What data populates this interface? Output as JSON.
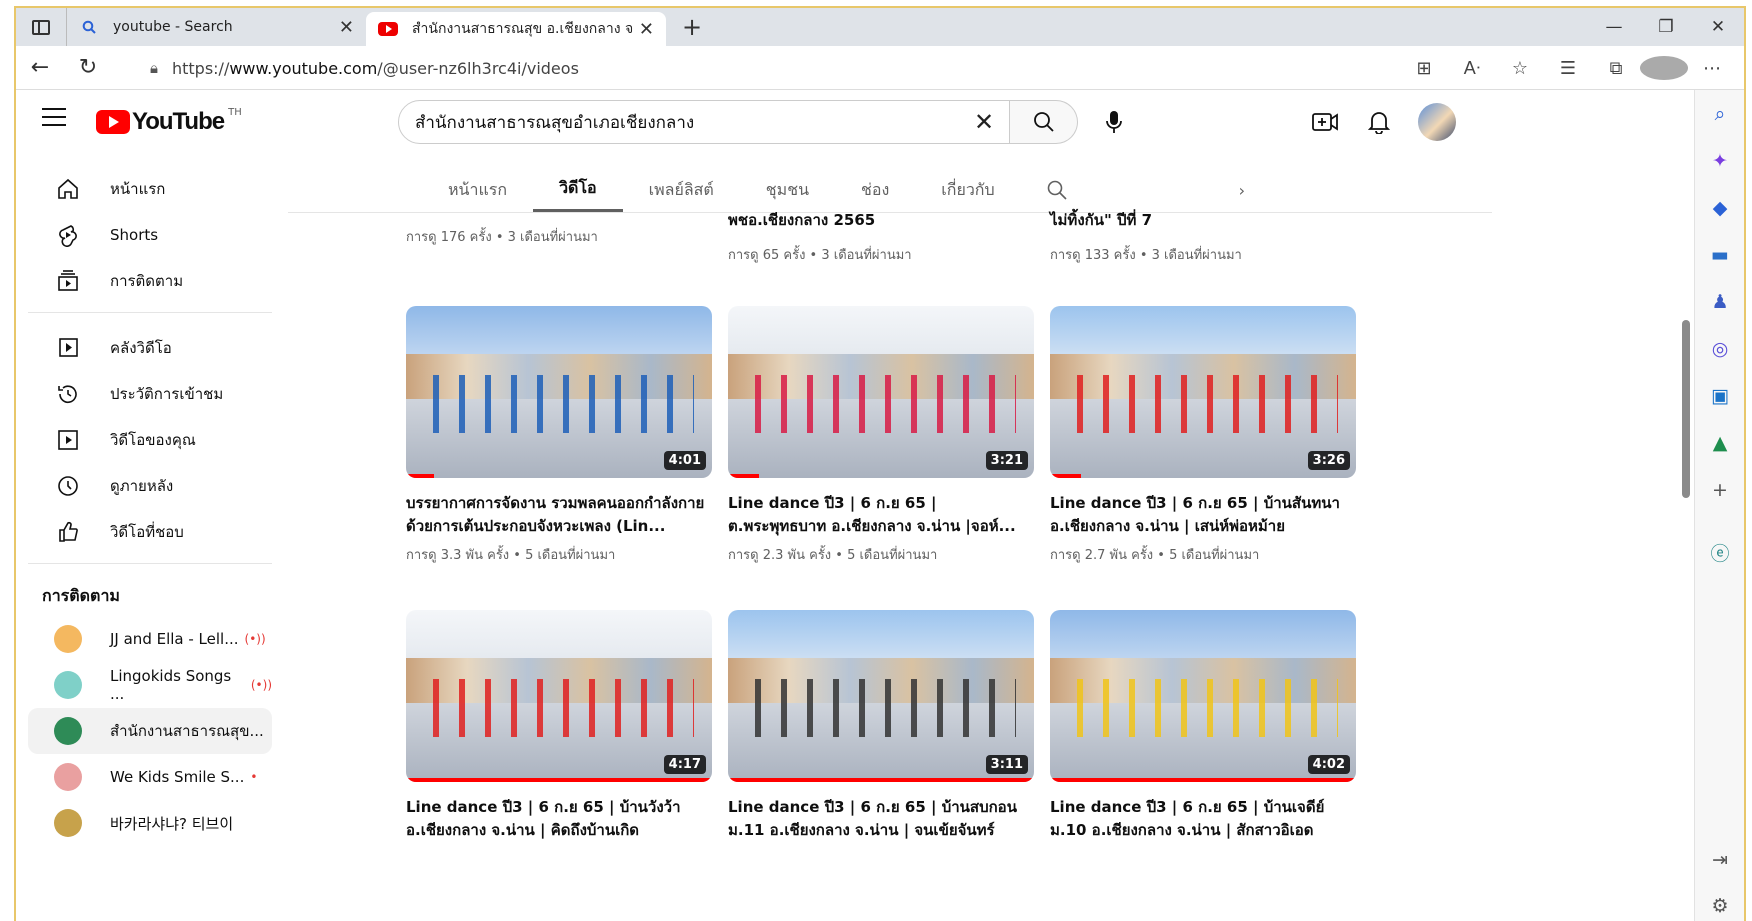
{
  "browser": {
    "tabs": [
      {
        "title": "youtube - Search"
      },
      {
        "title": "สำนักงานสาธารณสุข อ.เชียงกลาง จ.น่"
      }
    ],
    "url_prefix": "https://",
    "url_host": "www.youtube.com",
    "url_path": "/@user-nz6lh3rc4i/videos"
  },
  "youtube": {
    "logo_text": "YouTube",
    "region": "TH",
    "search_query": "สำนักงานสาธารณสุขอำเภอเชียงกลาง",
    "nav": [
      {
        "label": "หน้าแรก",
        "icon": "home-icon"
      },
      {
        "label": "Shorts",
        "icon": "shorts-icon"
      },
      {
        "label": "การติดตาม",
        "icon": "subscriptions-icon"
      }
    ],
    "nav2": [
      {
        "label": "คลังวิดีโอ",
        "icon": "library-icon"
      },
      {
        "label": "ประวัติการเข้าชม",
        "icon": "history-icon"
      },
      {
        "label": "วิดีโอของคุณ",
        "icon": "your-videos-icon"
      },
      {
        "label": "ดูภายหลัง",
        "icon": "watch-later-icon"
      },
      {
        "label": "วิดีโอที่ชอบ",
        "icon": "like-icon"
      }
    ],
    "subs_title": "การติดตาม",
    "subs": [
      {
        "label": "JJ and Ella - Lell...",
        "live": "(•))",
        "color": "#f4b860"
      },
      {
        "label": "Lingokids Songs ...",
        "live": "(•))",
        "color": "#7fd0c8"
      },
      {
        "label": "สำนักงานสาธารณสุข...",
        "live": "",
        "color": "#2e8b57"
      },
      {
        "label": "We Kids Smile S...",
        "live": "•",
        "color": "#e9a0a0"
      },
      {
        "label": "바카라샤냐? 티브이",
        "live": "",
        "color": "#c7a24b"
      }
    ],
    "channel_tabs": [
      "หน้าแรก",
      "วิดีโอ",
      "เพลย์ลิสต์",
      "ชุมชน",
      "ช่อง",
      "เกี่ยวกับ"
    ],
    "partial_row": [
      {
        "title": "",
        "meta": "การดู 176 ครั้ง • 3 เดือนที่ผ่านมา"
      },
      {
        "title": "พชอ.เชียงกลาง 2565",
        "meta": "การดู 65 ครั้ง • 3 เดือนที่ผ่านมา"
      },
      {
        "title": "ไม่ทิ้งกัน\" ปีที่ 7",
        "meta": "การดู 133 ครั้ง • 3 เดือนที่ผ่านมา"
      }
    ],
    "videos": [
      {
        "title": "บรรยากาศการจัดงาน รวมพลคนออกกำลังกาย ด้วยการเต้นประกอบจังหวะเพลง (Lin...",
        "meta": "การดู 3.3 พัน ครั้ง • 5 เดือนที่ผ่านมา",
        "duration": "4:01",
        "watched": 0.09,
        "dancer": "#1d5fb8"
      },
      {
        "title": "Line dance ปี3 | 6 ก.ย 65 | ต.พระพุทธบาท อ.เชียงกลาง จ.น่าน |จอห์...",
        "meta": "การดู 2.3 พัน ครั้ง • 5 เดือนที่ผ่านมา",
        "duration": "3:21",
        "watched": 0.1,
        "dancer": "#d81b45"
      },
      {
        "title": "Line dance ปี3 | 6 ก.ย 65 | บ้านสันทนา อ.เชียงกลาง จ.น่าน | เสน่ห์พ่อหม้าย",
        "meta": "การดู 2.7 พัน ครั้ง • 5 เดือนที่ผ่านมา",
        "duration": "3:26",
        "watched": 0.1,
        "dancer": "#e01f1f"
      },
      {
        "title": "Line dance ปี3 | 6 ก.ย 65 | บ้านวังว้า อ.เชียงกลาง จ.น่าน | คิดถึงบ้านเกิด",
        "meta": "",
        "duration": "4:17",
        "watched": 1.0,
        "dancer": "#e0201f"
      },
      {
        "title": "Line dance ปี3 | 6 ก.ย 65 | บ้านสบกอน ม.11 อ.เชียงกลาง จ.น่าน | จนเข้ยจันทร์",
        "meta": "",
        "duration": "3:11",
        "watched": 1.0,
        "dancer": "#333333"
      },
      {
        "title": "Line dance ปี3 | 6 ก.ย 65 | บ้านเจดีย์ ม.10 อ.เชียงกลาง จ.น่าน | สักสาวอิเอด",
        "meta": "",
        "duration": "4:02",
        "watched": 1.0,
        "dancer": "#f0c419"
      }
    ]
  }
}
